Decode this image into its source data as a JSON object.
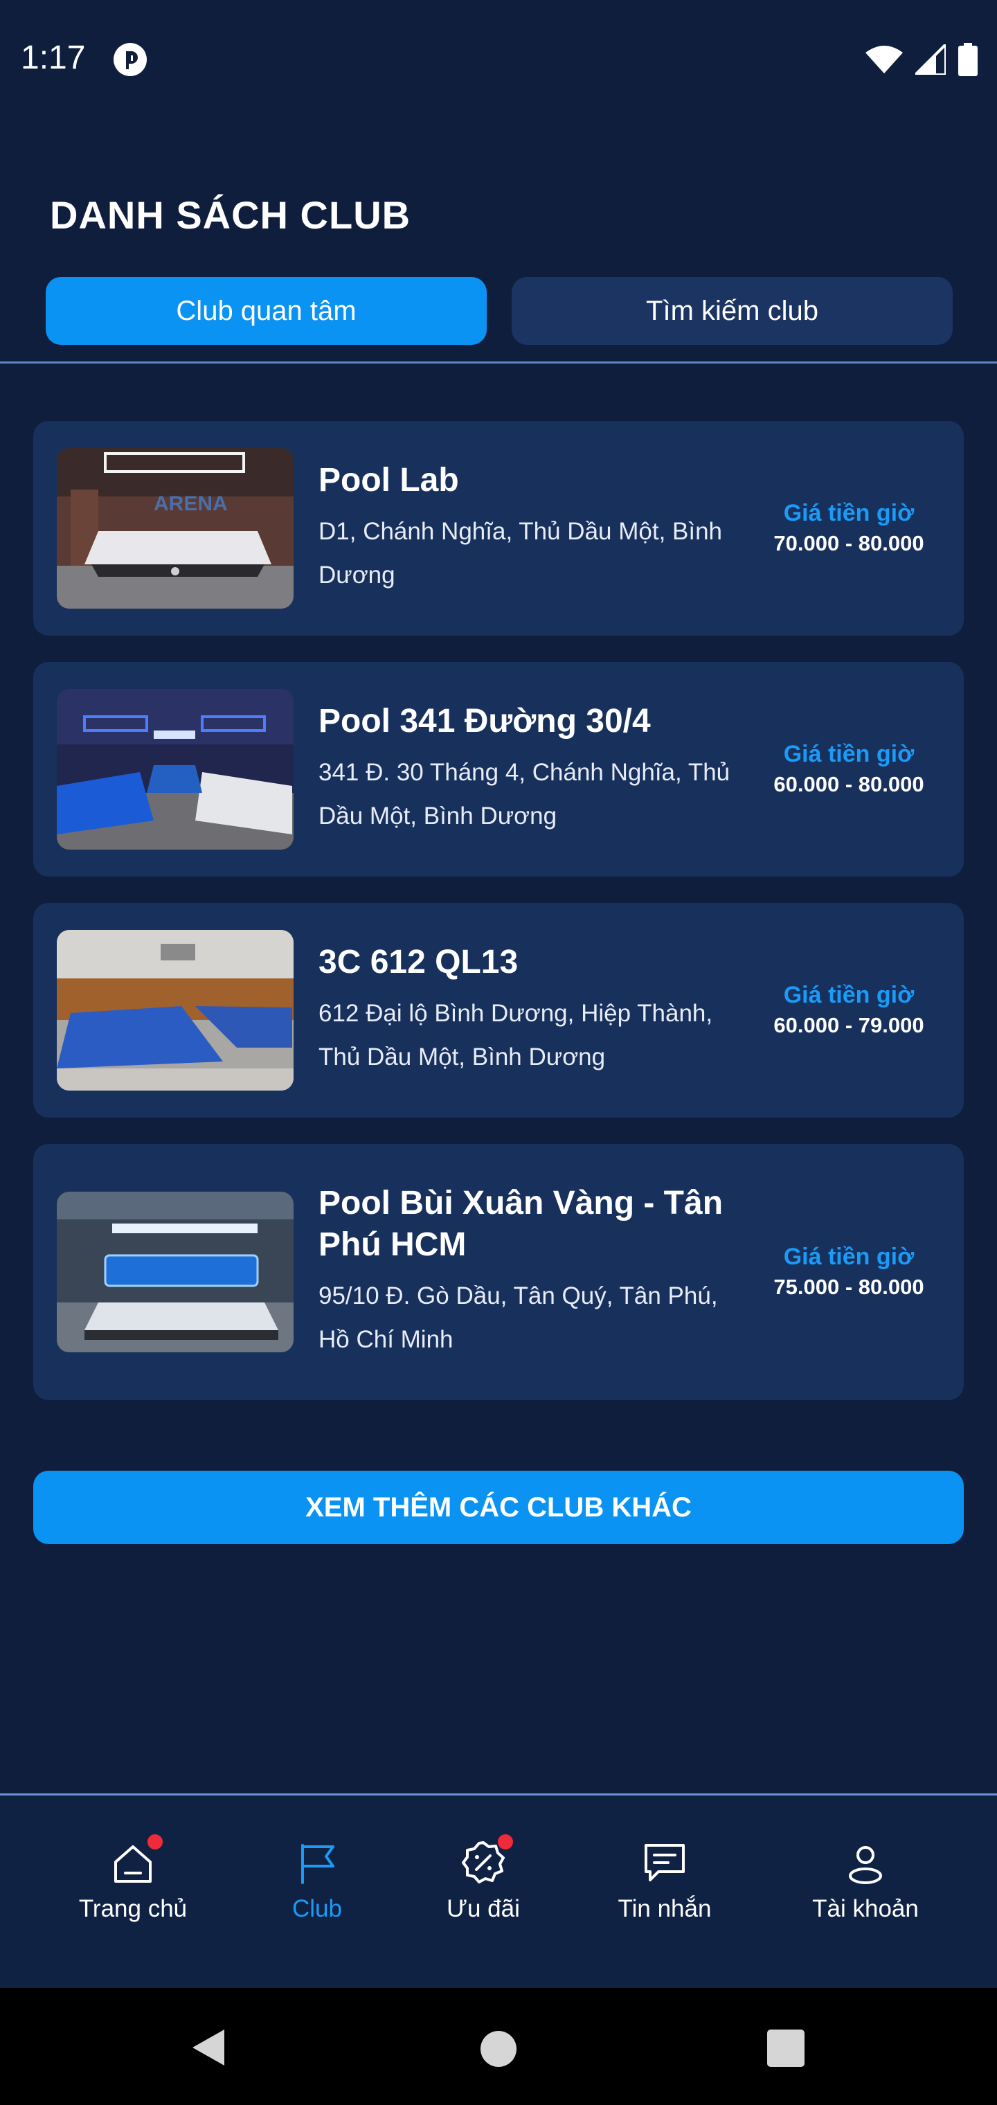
{
  "status_bar": {
    "time": "1:17"
  },
  "page": {
    "title": "DANH SÁCH CLUB"
  },
  "tabs": [
    {
      "label": "Club quan tâm",
      "active": true
    },
    {
      "label": "Tìm kiếm club",
      "active": false
    }
  ],
  "clubs": [
    {
      "name": "Pool Lab",
      "address": "D1, Chánh Nghĩa, Thủ Dầu Một, Bình Dương",
      "price_label": "Giá tiền giờ",
      "price": "70.000 - 80.000"
    },
    {
      "name": "Pool 341 Đường 30/4",
      "address": "341 Đ. 30 Tháng 4, Chánh Nghĩa, Thủ Dầu Một, Bình Dương",
      "price_label": "Giá tiền giờ",
      "price": "60.000 - 80.000"
    },
    {
      "name": "3C 612 QL13",
      "address": "612 Đại lộ Bình Dương, Hiệp Thành, Thủ Dầu Một, Bình Dương",
      "price_label": "Giá tiền giờ",
      "price": "60.000 - 79.000"
    },
    {
      "name": "Pool Bùi Xuân Vàng - Tân Phú HCM",
      "address": "95/10 Đ. Gò Dầu, Tân Quý, Tân Phú, Hồ Chí Minh",
      "price_label": "Giá tiền giờ",
      "price": "75.000 - 80.000"
    }
  ],
  "more_button": {
    "label": "XEM THÊM CÁC CLUB KHÁC"
  },
  "bottom_nav": [
    {
      "label": "Trang chủ",
      "icon": "home-icon",
      "badge": true,
      "active": false
    },
    {
      "label": "Club",
      "icon": "flag-icon",
      "badge": false,
      "active": true
    },
    {
      "label": "Ưu đãi",
      "icon": "discount-icon",
      "badge": true,
      "active": false
    },
    {
      "label": "Tin nhắn",
      "icon": "chat-icon",
      "badge": false,
      "active": false
    },
    {
      "label": "Tài khoản",
      "icon": "user-icon",
      "badge": false,
      "active": false
    }
  ],
  "colors": {
    "accent": "#0a93f2",
    "background": "#0f1e3c",
    "card": "#18305c",
    "badge": "#ef2b3b"
  }
}
